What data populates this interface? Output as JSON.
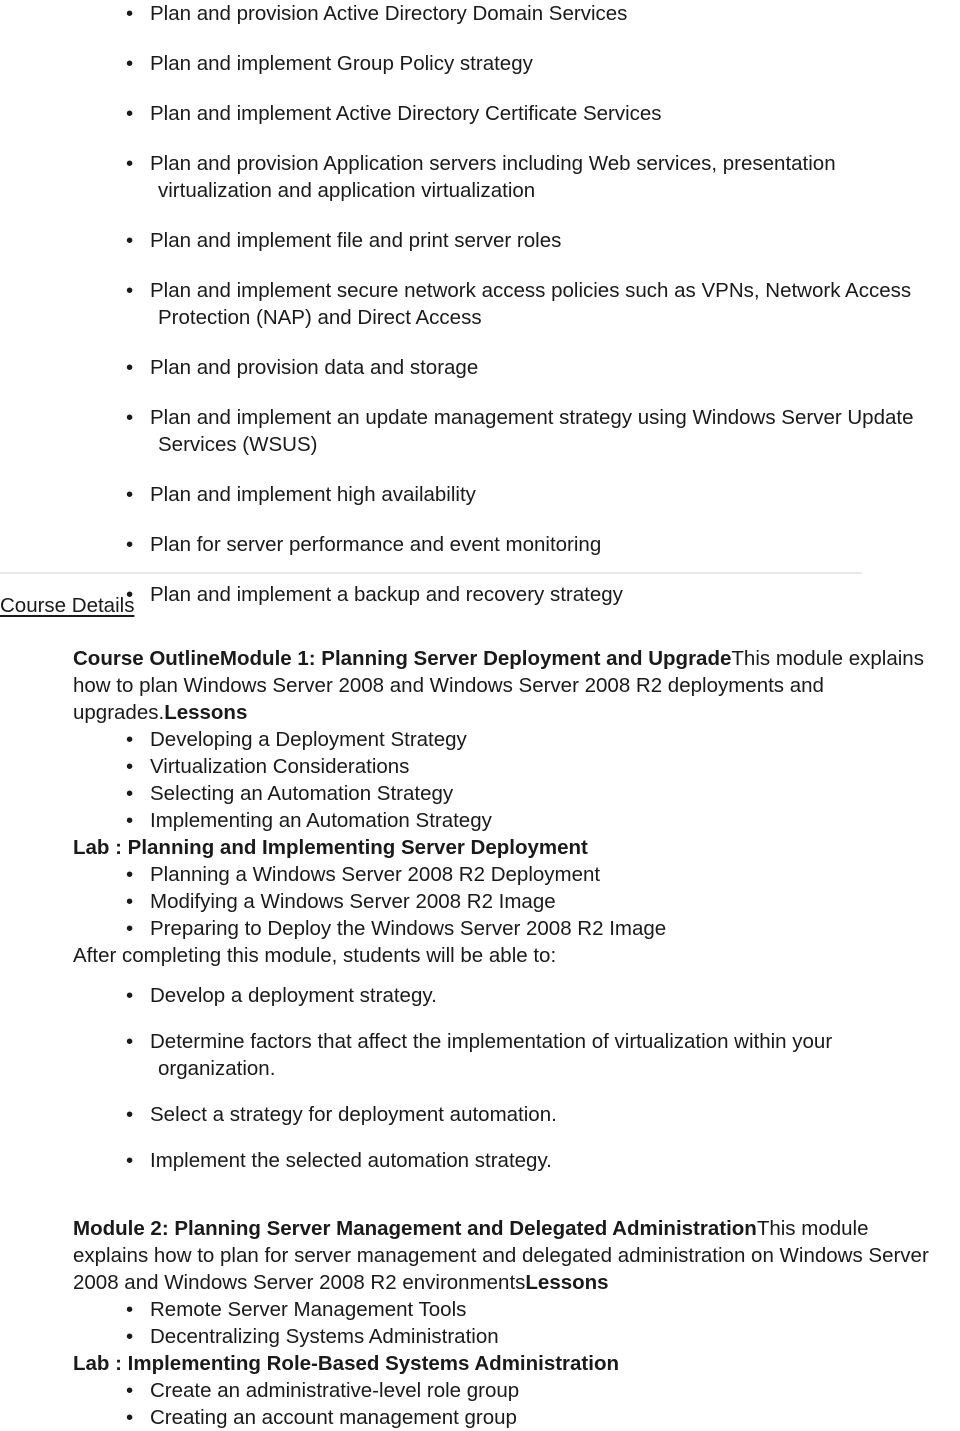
{
  "document": {
    "bullet_glyph": "•",
    "text_color": "#1a1a1a",
    "divider_color": "#e8e8e8"
  },
  "top_objectives": [
    "Plan and provision Active Directory Domain Services",
    "Plan and implement Group Policy strategy",
    "Plan and implement Active Directory Certificate Services",
    "Plan and provision Application servers including Web services, presentation virtualization and application virtualization",
    "Plan and implement file and print server roles",
    "Plan and implement secure network access policies such as VPNs, Network Access Protection (NAP) and Direct Access",
    "Plan and provision data and storage",
    "Plan and implement an update management strategy using Windows Server Update Services (WSUS)",
    "Plan and implement high availability",
    "Plan for server performance and event monitoring",
    "Plan and implement a backup and recovery strategy"
  ],
  "course_details": {
    "heading": "Course Details",
    "module1": {
      "title_bold": "Course OutlineModule 1: Planning Server Deployment and Upgrade",
      "description": "This module explains how to plan Windows Server 2008 and Windows Server 2008 R2 deployments and upgrades.",
      "lessons_label": "Lessons",
      "lessons": [
        "Developing a Deployment Strategy",
        "Virtualization Considerations",
        "Selecting an Automation Strategy",
        "Implementing an Automation Strategy"
      ],
      "lab_label": "Lab : Planning and Implementing Server Deployment",
      "lab_items": [
        "Planning a Windows Server 2008 R2 Deployment",
        "Modifying a Windows Server 2008 R2 Image",
        "Preparing to Deploy the Windows Server 2008 R2 Image"
      ],
      "outcomes_intro": "After completing this module, students will be able to:",
      "outcomes": [
        "Develop a deployment strategy.",
        "Determine factors that affect the implementation of virtualization within your organization.",
        "Select a strategy for deployment automation.",
        "Implement the selected automation strategy."
      ]
    },
    "module2": {
      "title_bold": "Module 2: Planning Server Management and Delegated Administration",
      "description": "This module explains how to plan for server management and delegated administration on Windows Server 2008 and Windows Server 2008 R2 environments",
      "lessons_label": "Lessons",
      "lessons": [
        "Remote Server Management Tools",
        "Decentralizing Systems Administration"
      ],
      "lab_label": "Lab : Implementing Role-Based Systems Administration",
      "lab_items": [
        "Create an administrative-level role group",
        "Creating an account management group"
      ]
    }
  }
}
